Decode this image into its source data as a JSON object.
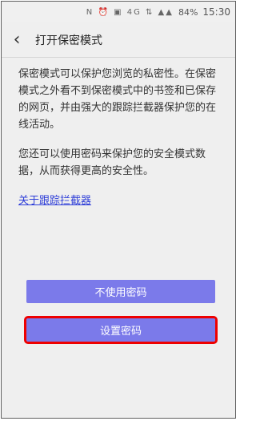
{
  "status": {
    "icons": "N ⏰ ▣ 4G ⇅ ▲▲",
    "battery": "84%",
    "time": "15:30"
  },
  "header": {
    "title": "打开保密模式"
  },
  "content": {
    "paragraph1": "保密模式可以保护您浏览的私密性。在保密模式之外看不到保密模式中的书签和已保存的网页，并由强大的跟踪拦截器保护您的在线活动。",
    "paragraph2": "您还可以使用密码来保护您的安全模式数据，从而获得更高的安全性。",
    "link": "关于跟踪拦截器"
  },
  "buttons": {
    "no_password": "不使用密码",
    "set_password": "设置密码"
  }
}
